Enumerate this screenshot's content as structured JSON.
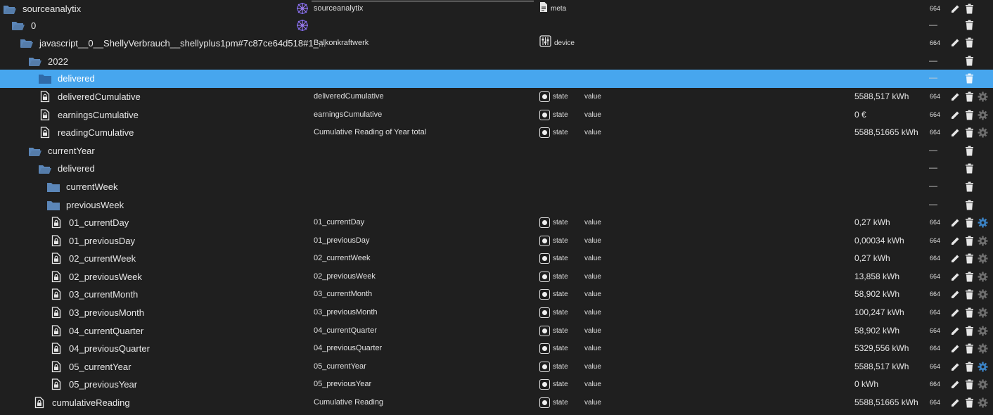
{
  "rows": [
    {
      "name": "sourceanalytix",
      "icon": "folder-open",
      "common_name": "sourceanalytix",
      "obj_icon": "adapter",
      "type": "meta",
      "role": "",
      "value": "",
      "acl": "664",
      "actions": [
        "edit",
        "delete"
      ]
    },
    {
      "name": "0",
      "icon": "folder-open",
      "common_name": "",
      "obj_icon": "adapter",
      "type": "",
      "role": "",
      "value": "",
      "acl": "—",
      "actions": [
        "delete"
      ]
    },
    {
      "name": "javascript__0__ShellyVerbrauch__shellyplus1pm#7c87ce64d518#1_...",
      "icon": "folder-open",
      "common_name": "Balkonkraftwerk",
      "obj_icon": "device",
      "type": "device",
      "role": "",
      "value": "",
      "acl": "664",
      "actions": [
        "edit",
        "delete"
      ]
    },
    {
      "name": "2022",
      "icon": "folder-open",
      "common_name": "",
      "obj_icon": "",
      "type": "",
      "role": "",
      "value": "",
      "acl": "—",
      "actions": [
        "delete"
      ]
    },
    {
      "name": "delivered",
      "icon": "folder-closed",
      "common_name": "",
      "obj_icon": "",
      "type": "",
      "role": "",
      "value": "",
      "acl": "—",
      "actions": [
        "delete"
      ],
      "selected": true
    },
    {
      "name": "deliveredCumulative",
      "icon": "file-lock",
      "common_name": "deliveredCumulative",
      "obj_icon": "state",
      "type": "state",
      "role": "value",
      "value": "5588,517 kWh",
      "acl": "664",
      "actions": [
        "edit",
        "delete",
        "settings"
      ]
    },
    {
      "name": "earningsCumulative",
      "icon": "file-lock",
      "common_name": "earningsCumulative",
      "obj_icon": "state",
      "type": "state",
      "role": "value",
      "value": "0 €",
      "acl": "664",
      "actions": [
        "edit",
        "delete",
        "settings"
      ]
    },
    {
      "name": "readingCumulative",
      "icon": "file-lock",
      "common_name": "Cumulative Reading of Year total",
      "obj_icon": "state",
      "type": "state",
      "role": "value",
      "value": "5588,51665 kWh",
      "acl": "664",
      "actions": [
        "edit",
        "delete",
        "settings"
      ]
    },
    {
      "name": "currentYear",
      "icon": "folder-open",
      "common_name": "",
      "obj_icon": "",
      "type": "",
      "role": "",
      "value": "",
      "acl": "—",
      "actions": [
        "delete"
      ]
    },
    {
      "name": "delivered",
      "icon": "folder-open",
      "common_name": "",
      "obj_icon": "",
      "type": "",
      "role": "",
      "value": "",
      "acl": "—",
      "actions": [
        "delete"
      ]
    },
    {
      "name": "currentWeek",
      "icon": "folder-closed",
      "common_name": "",
      "obj_icon": "",
      "type": "",
      "role": "",
      "value": "",
      "acl": "—",
      "actions": [
        "delete"
      ]
    },
    {
      "name": "previousWeek",
      "icon": "folder-closed",
      "common_name": "",
      "obj_icon": "",
      "type": "",
      "role": "",
      "value": "",
      "acl": "—",
      "actions": [
        "delete"
      ]
    },
    {
      "name": "01_currentDay",
      "icon": "file-lock",
      "common_name": "01_currentDay",
      "obj_icon": "state",
      "type": "state",
      "role": "value",
      "value": "0,27 kWh",
      "acl": "664",
      "actions": [
        "edit",
        "delete",
        "settings"
      ],
      "settings_active": true
    },
    {
      "name": "01_previousDay",
      "icon": "file-lock",
      "common_name": "01_previousDay",
      "obj_icon": "state",
      "type": "state",
      "role": "value",
      "value": "0,00034 kWh",
      "acl": "664",
      "actions": [
        "edit",
        "delete",
        "settings"
      ]
    },
    {
      "name": "02_currentWeek",
      "icon": "file-lock",
      "common_name": "02_currentWeek",
      "obj_icon": "state",
      "type": "state",
      "role": "value",
      "value": "0,27 kWh",
      "acl": "664",
      "actions": [
        "edit",
        "delete",
        "settings"
      ]
    },
    {
      "name": "02_previousWeek",
      "icon": "file-lock",
      "common_name": "02_previousWeek",
      "obj_icon": "state",
      "type": "state",
      "role": "value",
      "value": "13,858 kWh",
      "acl": "664",
      "actions": [
        "edit",
        "delete",
        "settings"
      ]
    },
    {
      "name": "03_currentMonth",
      "icon": "file-lock",
      "common_name": "03_currentMonth",
      "obj_icon": "state",
      "type": "state",
      "role": "value",
      "value": "58,902 kWh",
      "acl": "664",
      "actions": [
        "edit",
        "delete",
        "settings"
      ]
    },
    {
      "name": "03_previousMonth",
      "icon": "file-lock",
      "common_name": "03_previousMonth",
      "obj_icon": "state",
      "type": "state",
      "role": "value",
      "value": "100,247 kWh",
      "acl": "664",
      "actions": [
        "edit",
        "delete",
        "settings"
      ]
    },
    {
      "name": "04_currentQuarter",
      "icon": "file-lock",
      "common_name": "04_currentQuarter",
      "obj_icon": "state",
      "type": "state",
      "role": "value",
      "value": "58,902 kWh",
      "acl": "664",
      "actions": [
        "edit",
        "delete",
        "settings"
      ]
    },
    {
      "name": "04_previousQuarter",
      "icon": "file-lock",
      "common_name": "04_previousQuarter",
      "obj_icon": "state",
      "type": "state",
      "role": "value",
      "value": "5329,556 kWh",
      "acl": "664",
      "actions": [
        "edit",
        "delete",
        "settings"
      ]
    },
    {
      "name": "05_currentYear",
      "icon": "file-lock",
      "common_name": "05_currentYear",
      "obj_icon": "state",
      "type": "state",
      "role": "value",
      "value": "5588,517 kWh",
      "acl": "664",
      "actions": [
        "edit",
        "delete",
        "settings"
      ],
      "settings_active": true
    },
    {
      "name": "05_previousYear",
      "icon": "file-lock",
      "common_name": "05_previousYear",
      "obj_icon": "state",
      "type": "state",
      "role": "value",
      "value": "0 kWh",
      "acl": "664",
      "actions": [
        "edit",
        "delete",
        "settings"
      ]
    },
    {
      "name": "cumulativeReading",
      "icon": "file-lock",
      "common_name": "Cumulative Reading",
      "obj_icon": "state",
      "type": "state",
      "role": "value",
      "value": "5588,51665 kWh",
      "acl": "664",
      "actions": [
        "edit",
        "delete",
        "settings"
      ]
    }
  ],
  "colors": {
    "background": "#1f1f1f",
    "selected_row": "#47a6ee",
    "folder": "#5b86b8",
    "folder_selected": "#2f6aa8",
    "settings_active": "#3b82c4",
    "settings_inactive": "#6f6f6f",
    "adapter_icon": "#6e5bd6"
  }
}
